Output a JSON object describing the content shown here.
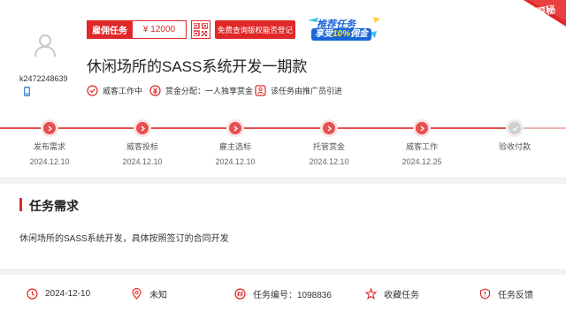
{
  "header": {
    "username": "k2472248639",
    "badge_type": "雇佣任务",
    "price": "¥ 12000",
    "copyright_button": "免费查询版权能否登记",
    "promo_line1": "推荐任务",
    "promo_line2_prefix": "享受",
    "promo_line2_highlight": "10%",
    "promo_line2_suffix": "佣金",
    "corner_label": "探秘",
    "title": "休闲场所的SASS系统开发一期款",
    "meta": [
      {
        "icon": "check-circle-icon",
        "label": "威客工作中"
      },
      {
        "icon": "coin-icon",
        "label": "赏金分配：一人独享赏金"
      },
      {
        "icon": "guide-icon",
        "label": "该任务由推广员引进"
      }
    ]
  },
  "progress": {
    "steps": [
      {
        "name": "发布需求",
        "date": "2024.12.10",
        "done": true
      },
      {
        "name": "威客投标",
        "date": "2024.12.10",
        "done": true
      },
      {
        "name": "雇主选标",
        "date": "2024.12.10",
        "done": true
      },
      {
        "name": "托管赏金",
        "date": "2024.12.10",
        "done": true
      },
      {
        "name": "威客工作",
        "date": "2024.12.25",
        "done": true
      },
      {
        "name": "验收付款",
        "date": "",
        "done": false
      }
    ]
  },
  "requirement": {
    "title": "任务需求",
    "body": "休闲场所的SASS系统开发，具体按照签订的合同开发"
  },
  "footer": {
    "date": "2024-12-10",
    "location": "未知",
    "task_no": "任务编号：1098836",
    "favorite": "收藏任务",
    "feedback": "任务反馈"
  },
  "colors": {
    "accent": "#e02828",
    "progress_done": "#e55050",
    "progress_todo": "#cfcfcf",
    "promo_blue": "#1a66d8"
  }
}
